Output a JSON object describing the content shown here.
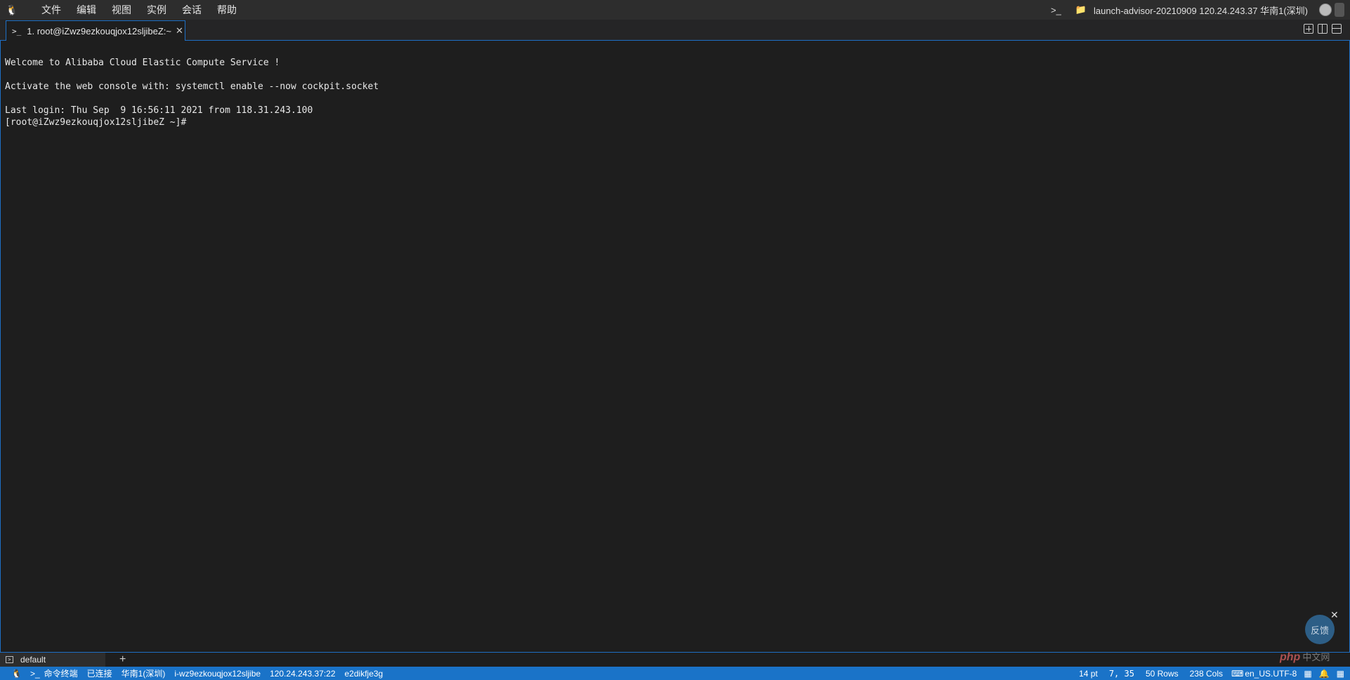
{
  "menubar": {
    "logo_icon": "linux-penguin-icon",
    "items": [
      "文件",
      "编辑",
      "视图",
      "实例",
      "会话",
      "帮助"
    ],
    "right": {
      "terminal_icon": ">_",
      "folder_icon": "folder-icon",
      "instance_info": "launch-advisor-20210909 120.24.243.37 华南1(深圳)"
    }
  },
  "tab": {
    "prompt_icon": ">_",
    "label": "1. root@iZwz9ezkouqjox12sljibeZ:~",
    "close": "✕"
  },
  "terminal": {
    "lines": [
      "Welcome to Alibaba Cloud Elastic Compute Service !",
      "",
      "Activate the web console with: systemctl enable --now cockpit.socket",
      "",
      "Last login: Thu Sep  9 16:56:11 2021 from 118.31.243.100",
      "[root@iZwz9ezkouqjox12sljibeZ ~]#"
    ]
  },
  "feedback": {
    "label": "反馈",
    "close": "✕"
  },
  "session": {
    "tab_label": "default",
    "add": "+"
  },
  "statusbar": {
    "left": [
      "命令终端",
      "已连接",
      "华南1(深圳)",
      "i-wz9ezkouqjox12sljibe",
      "120.24.243.37:22",
      "e2dikfje3g"
    ],
    "right": [
      "14 pt",
      "7, 35",
      "50 Rows",
      "238 Cols",
      "en_US.UTF-8"
    ],
    "terminal_icon": ">_"
  },
  "watermark": {
    "text": "php",
    "cn": "中文网"
  }
}
